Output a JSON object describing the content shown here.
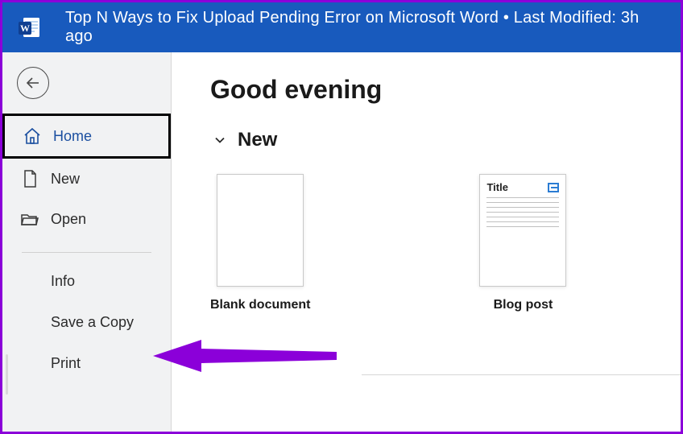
{
  "header": {
    "title": "Top N Ways to Fix Upload Pending Error on Microsoft Word • Last Modified: 3h ago"
  },
  "sidebar": {
    "home_label": "Home",
    "new_label": "New",
    "open_label": "Open",
    "info_label": "Info",
    "save_copy_label": "Save a Copy",
    "print_label": "Print"
  },
  "main": {
    "greeting": "Good evening",
    "new_section_label": "New",
    "templates": [
      {
        "label": "Blank document"
      },
      {
        "label": "Blog post",
        "tile_title": "Title"
      }
    ]
  },
  "icons": {
    "word_logo": "word-logo",
    "back": "back-arrow-icon",
    "home": "home-icon",
    "new_doc": "page-icon",
    "open": "folder-open-icon",
    "chevron": "chevron-down-icon"
  }
}
